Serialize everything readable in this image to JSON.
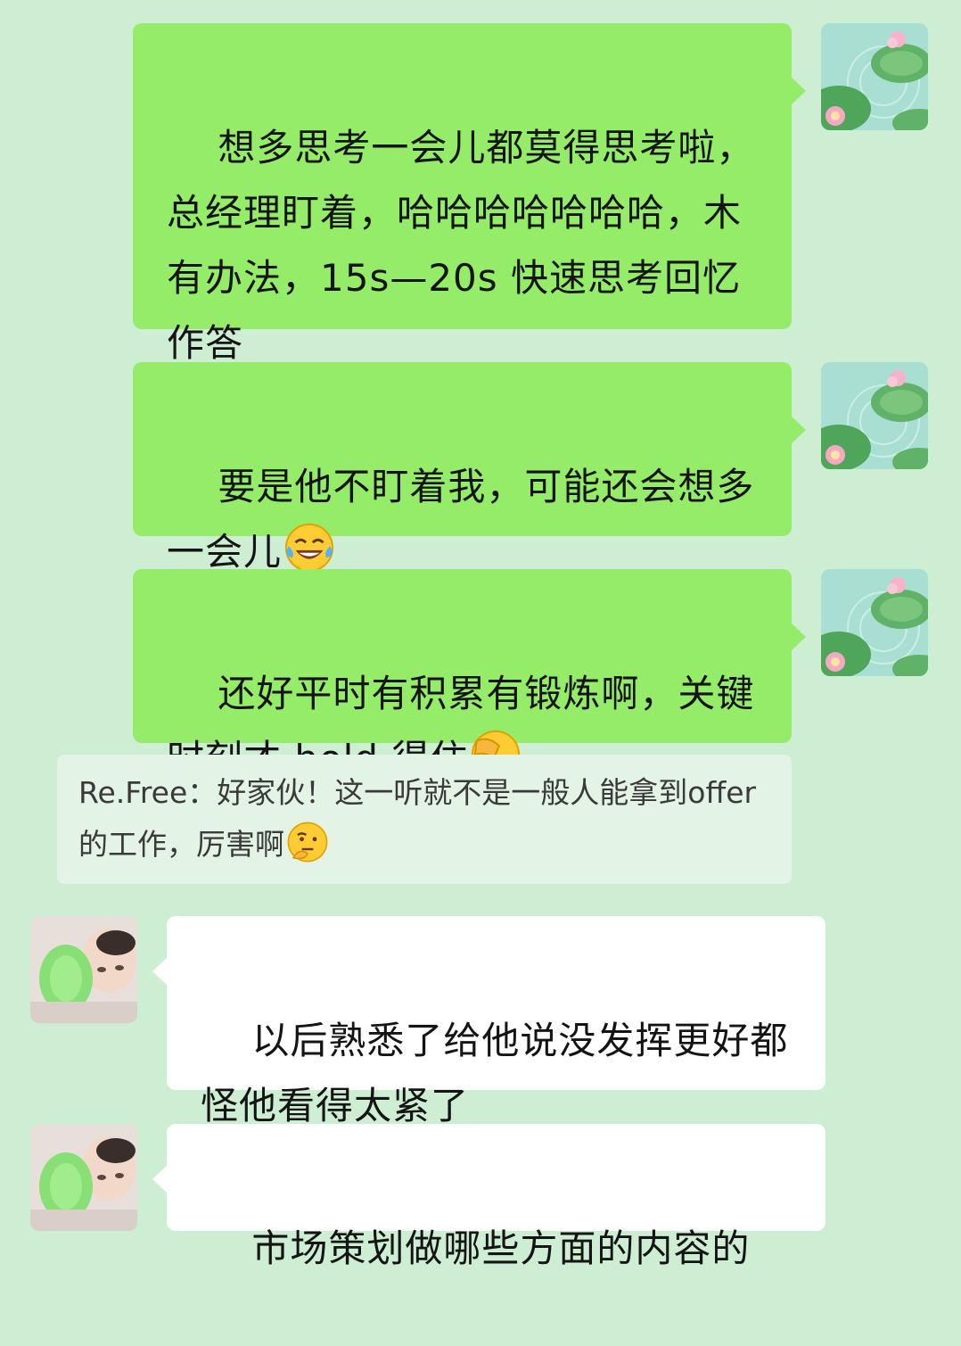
{
  "messages": [
    {
      "id": "m1",
      "side": "out",
      "text": "想多思考一会儿都莫得思考啦，总经理盯着，哈哈哈哈哈哈哈，木有办法，15s—20s 快速思考回忆作答",
      "emoji": ""
    },
    {
      "id": "m2",
      "side": "out",
      "text": "要是他不盯着我，可能还会想多一会儿",
      "emoji": "face-with-tears-of-joy"
    },
    {
      "id": "m3",
      "side": "out",
      "text": "还好平时有积累有锻炼啊，关键时刻才 hold 得住",
      "emoji": "facepalm"
    },
    {
      "id": "m4",
      "side": "in",
      "text": "以后熟悉了给他说没发挥更好都怪他看得太紧了",
      "emoji": ""
    },
    {
      "id": "m5",
      "side": "in",
      "text": "市场策划做哪些方面的内容的",
      "emoji": ""
    }
  ],
  "quote": {
    "author": "Re.Free",
    "separator": "：",
    "text": "好家伙！这一听就不是一般人能拿到offer的工作，厉害啊",
    "emoji": "thinking-face"
  },
  "avatars": {
    "self": "lotus-pond-avatar",
    "other": "girl-with-bottle-avatar"
  },
  "colors": {
    "background": "#cdeed3",
    "bubble_out": "#95ec69",
    "bubble_in": "#ffffff",
    "quote_bg": "#e3f3e6"
  }
}
